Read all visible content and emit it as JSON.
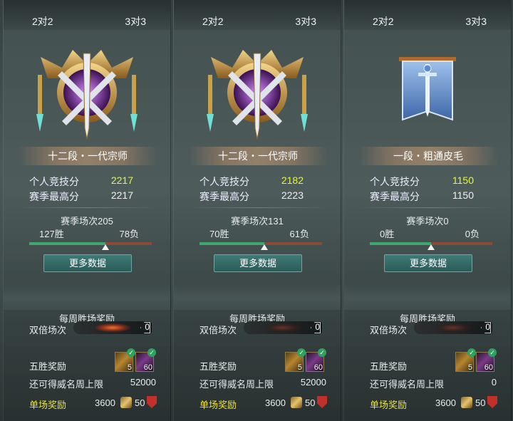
{
  "panels": [
    {
      "tabs": [
        "2对2",
        "3对3"
      ],
      "emblem": "grandmaster-sword-crest-icon",
      "rank_title": "十二段・一代宗师",
      "personal_label": "个人竞技分",
      "personal_value": "2217",
      "season_high_label": "赛季最高分",
      "season_high_value": "2217",
      "season_matches": "赛季场次205",
      "wins": "127胜",
      "losses": "78负",
      "win_fraction": 0.62,
      "more_button": "更多数据",
      "weekly_title": "每周胜场奖励",
      "double_label": "双倍场次",
      "double_count": "0",
      "five_win_label": "五胜奖励",
      "item_counts": [
        "5",
        "60"
      ],
      "fame_label": "还可得威名周上限",
      "fame_value": "52000",
      "single_label": "单场奖励",
      "single_value1": "3600",
      "single_value2": "50"
    },
    {
      "tabs": [
        "2对2",
        "3对3"
      ],
      "emblem": "grandmaster-sword-crest-icon",
      "rank_title": "十二段・一代宗师",
      "personal_label": "个人竞技分",
      "personal_value": "2182",
      "season_high_label": "赛季最高分",
      "season_high_value": "2223",
      "season_matches": "赛季场次131",
      "wins": "70胜",
      "losses": "61负",
      "win_fraction": 0.53,
      "more_button": "更多数据",
      "weekly_title": "每周胜场奖励",
      "double_label": "双倍场次",
      "double_count": "0",
      "five_win_label": "五胜奖励",
      "item_counts": [
        "5",
        "60"
      ],
      "fame_label": "还可得威名周上限",
      "fame_value": "52000",
      "single_label": "单场奖励",
      "single_value1": "3600",
      "single_value2": "50"
    },
    {
      "tabs": [
        "2对2",
        "3对3"
      ],
      "emblem": "banner-sword-icon",
      "rank_title": "一段・粗通皮毛",
      "personal_label": "个人竞技分",
      "personal_value": "1150",
      "season_high_label": "赛季最高分",
      "season_high_value": "1150",
      "season_matches": "赛季场次0",
      "wins": "0胜",
      "losses": "0负",
      "win_fraction": 0.5,
      "more_button": "更多数据",
      "weekly_title": "每周胜场奖励",
      "double_label": "双倍场次",
      "double_count": "0",
      "five_win_label": "五胜奖励",
      "item_counts": [
        "5",
        "60"
      ],
      "fame_label": "还可得威名周上限",
      "fame_value": "0",
      "single_label": "单场奖励",
      "single_value1": "3600",
      "single_value2": "50"
    }
  ],
  "colors": {
    "highlight_score": "#e8f53a",
    "win_track": "#3fa870",
    "loss_track": "#8a4a35",
    "single_reward_label": "#e8e23a"
  }
}
